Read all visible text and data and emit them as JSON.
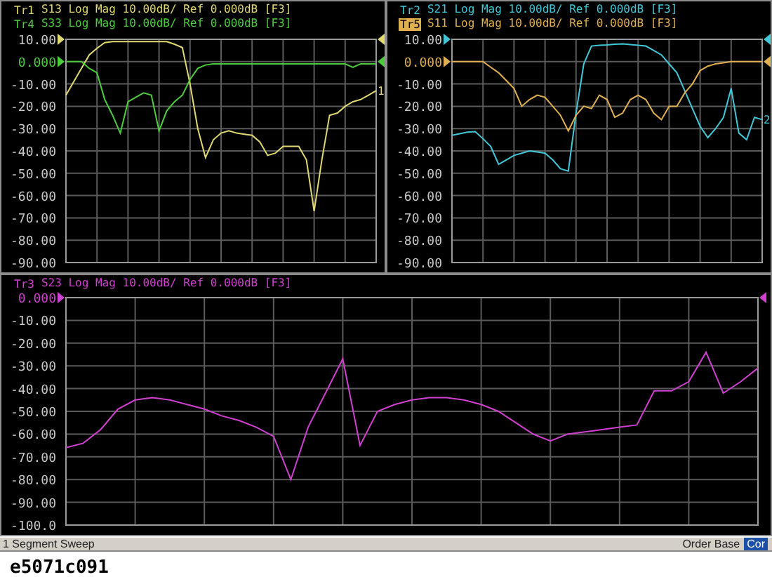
{
  "panels": [
    {
      "traces": [
        {
          "text": "S13 Log Mag 10.00dB/ Ref 0.000dB [F3]",
          "selected": false,
          "end_marker": "1"
        },
        {
          "text": "S33 Log Mag 10.00dB/ Ref 0.000dB [F3]",
          "selected": false
        }
      ],
      "chart_data": {
        "type": "line",
        "grid": true,
        "ylim": [
          -90,
          10
        ],
        "yticks": [
          {
            "value": 10,
            "label": "10.00"
          },
          {
            "value": 0,
            "label": "0.000"
          },
          {
            "value": -10,
            "label": "-10.00"
          },
          {
            "value": -20,
            "label": "-20.00"
          },
          {
            "value": -30,
            "label": "-30.00"
          },
          {
            "value": -40,
            "label": "-40.00"
          },
          {
            "value": -50,
            "label": "-50.00"
          },
          {
            "value": -60,
            "label": "-60.00"
          },
          {
            "value": -70,
            "label": "-70.00"
          },
          {
            "value": -80,
            "label": "-80.00"
          },
          {
            "value": -90,
            "label": "-90.00"
          }
        ],
        "series": [
          {
            "name": "Tr1",
            "color": "#e0d870",
            "values": [
              -15,
              -9,
              -3,
              3,
              6,
              8.5,
              9,
              9,
              9,
              9,
              9,
              9,
              9,
              9,
              7.8,
              6.3,
              -10,
              -30,
              -43,
              -35,
              -32,
              -31,
              -32,
              -32.5,
              -33,
              -36,
              -42,
              -41,
              -38,
              -38,
              -38,
              -44,
              -67,
              -44,
              -24,
              -23,
              -20,
              -18,
              -17,
              -15,
              -13
            ]
          },
          {
            "name": "Tr4",
            "color": "#4ccc3c",
            "values": [
              0,
              0,
              0,
              -3,
              -5,
              -17,
              -24,
              -32,
              -18,
              -16,
              -14,
              -15,
              -31,
              -22,
              -18,
              -15,
              -8,
              -3,
              -1.5,
              -1,
              -1,
              -1,
              -1,
              -1,
              -1,
              -1,
              -1,
              -1,
              -1,
              -1,
              -1,
              -1,
              -1,
              -1,
              -1,
              -1,
              -1,
              -2.5,
              -1,
              -1,
              -1
            ]
          }
        ]
      }
    },
    {
      "traces": [
        {
          "text": "S21 Log Mag 10.00dB/ Ref 0.000dB [F3]",
          "selected": false,
          "end_marker": "2"
        },
        {
          "text": "S11 Log Mag 10.00dB/ Ref 0.000dB [F3]",
          "selected": true
        }
      ],
      "chart_data": {
        "type": "line",
        "grid": true,
        "ylim": [
          -90,
          10
        ],
        "yticks": [
          {
            "value": 10,
            "label": "10.00"
          },
          {
            "value": 0,
            "label": "0.000"
          },
          {
            "value": -10,
            "label": "-10.00"
          },
          {
            "value": -20,
            "label": "-20.00"
          },
          {
            "value": -30,
            "label": "-30.00"
          },
          {
            "value": -40,
            "label": "-40.00"
          },
          {
            "value": -50,
            "label": "-50.00"
          },
          {
            "value": -60,
            "label": "-60.00"
          },
          {
            "value": -70,
            "label": "-70.00"
          },
          {
            "value": -80,
            "label": "-80.00"
          },
          {
            "value": -90,
            "label": "-90.00"
          }
        ],
        "series": [
          {
            "name": "Tr2",
            "color": "#40c8d8",
            "values": [
              -33,
              -32.3,
              -31.6,
              -31.4,
              -34.5,
              -38,
              -46,
              -44,
              -42,
              -41,
              -40,
              -40.5,
              -41,
              -44,
              -48,
              -49,
              -23,
              -1,
              7,
              7.3,
              7.5,
              7.8,
              8,
              7.7,
              7.3,
              7,
              5,
              3,
              -1,
              -5,
              -13,
              -21,
              -29,
              -34,
              -30,
              -25,
              -12,
              -32,
              -35,
              -25,
              -26
            ]
          },
          {
            "name": "Tr5",
            "color": "#e0b050",
            "values": [
              0,
              0,
              0,
              0,
              0,
              -2.5,
              -5,
              -8.5,
              -12,
              -20,
              -17,
              -15,
              -16,
              -20,
              -24,
              -31,
              -24,
              -20,
              -21,
              -15,
              -17,
              -25,
              -23,
              -17,
              -15,
              -17,
              -23,
              -26,
              -20,
              -20,
              -14,
              -10,
              -4,
              -2,
              -1,
              -0.5,
              0,
              0,
              0,
              0,
              0
            ]
          }
        ]
      }
    },
    {
      "traces": [
        {
          "text": "S23 Log Mag 10.00dB/ Ref 0.000dB [F3]",
          "selected": false
        }
      ],
      "chart_data": {
        "type": "line",
        "grid": true,
        "ylim": [
          -100,
          0
        ],
        "yticks": [
          {
            "value": 0,
            "label": "0.000"
          },
          {
            "value": -10,
            "label": "-10.00"
          },
          {
            "value": -20,
            "label": "-20.00"
          },
          {
            "value": -30,
            "label": "-30.00"
          },
          {
            "value": -40,
            "label": "-40.00"
          },
          {
            "value": -50,
            "label": "-50.00"
          },
          {
            "value": -60,
            "label": "-60.00"
          },
          {
            "value": -70,
            "label": "-70.00"
          },
          {
            "value": -80,
            "label": "-80.00"
          },
          {
            "value": -90,
            "label": "-90.00"
          },
          {
            "value": -100,
            "label": "-100.0"
          }
        ],
        "series": [
          {
            "name": "Tr3",
            "color": "#d040d0",
            "values": [
              -66,
              -64,
              -58,
              -49,
              -45,
              -44,
              -45,
              -47,
              -49,
              -52,
              -54,
              -57,
              -61,
              -80,
              -57,
              -42,
              -27,
              -65,
              -50,
              -47,
              -45,
              -44,
              -44,
              -45,
              -47,
              -50,
              -55,
              -60,
              -63,
              -60,
              -59,
              -58,
              -57,
              -56,
              -41,
              -41,
              -37,
              -24,
              -42,
              -37,
              -31
            ]
          }
        ]
      }
    }
  ],
  "status_bar": {
    "sweep": "1 Segment Sweep",
    "order": "Order Base",
    "correction": "Cor"
  },
  "caption": "e5071c091"
}
